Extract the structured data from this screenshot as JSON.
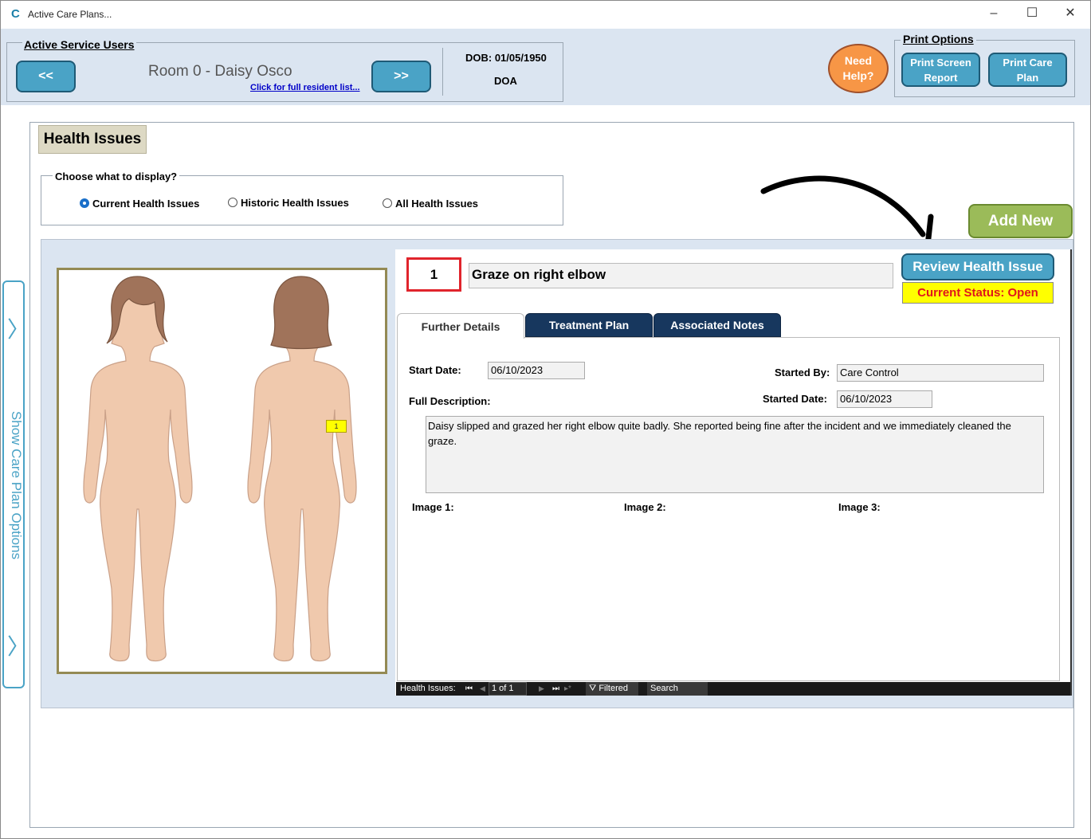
{
  "window": {
    "title": "Active Care Plans...",
    "logo": "C",
    "minimize_icon": "–",
    "maximize_icon": "☐",
    "close_icon": "✕"
  },
  "service_users": {
    "legend": "Active Service Users",
    "prev_label": "<<",
    "next_label": ">>",
    "resident_name": "Room 0 - Daisy Osco",
    "resident_link": "Click for full resident list...",
    "dob": "DOB: 01/05/1950",
    "doa": "DOA"
  },
  "help": {
    "label_line1": "Need",
    "label_line2": "Help?"
  },
  "print_options": {
    "legend": "Print Options",
    "screen_line1": "Print Screen",
    "screen_line2": "Report",
    "plan_line1": "Print Care",
    "plan_line2": "Plan"
  },
  "side_panel": {
    "label": "Show Care Plan Options",
    "chevron": "〉"
  },
  "health_issues": {
    "title": "Health Issues",
    "choose_legend": "Choose what to display?",
    "options": [
      {
        "label": "Current Health Issues",
        "selected": true
      },
      {
        "label": "Historic Health Issues",
        "selected": false
      },
      {
        "label": "All Health Issues",
        "selected": false
      }
    ],
    "add_new": "Add New"
  },
  "issue": {
    "number": "1",
    "title": "Graze on right elbow",
    "review_button": "Review Health Issue",
    "status": "Current Status: Open",
    "body_marker": "1"
  },
  "tabs": [
    "Further Details",
    "Treatment Plan",
    "Associated Notes"
  ],
  "details": {
    "start_date_label": "Start Date:",
    "start_date": "06/10/2023",
    "started_by_label": "Started By:",
    "started_by": "Care Control",
    "started_date_label": "Started Date:",
    "started_date": "06/10/2023",
    "full_description_label": "Full Description:",
    "full_description": "Daisy slipped and grazed her right elbow quite badly. She reported being fine after the incident and we immediately cleaned the graze.",
    "image1_label": "Image 1:",
    "image2_label": "Image 2:",
    "image3_label": "Image 3:"
  },
  "record_nav": {
    "label": "Health Issues:",
    "position": "1 of 1",
    "filter": "Filtered",
    "search": "Search"
  },
  "colors": {
    "header_bg": "#dbe5f1",
    "button_blue": "#4aa3c6",
    "help_orange": "#f79646",
    "add_green": "#9bbb59",
    "tab_navy": "#17375e",
    "status_yellow": "#ffff00",
    "status_red": "#e0141c",
    "number_border_red": "#e0242c",
    "skin": "#f0c9ad",
    "hair": "#a0735a"
  }
}
